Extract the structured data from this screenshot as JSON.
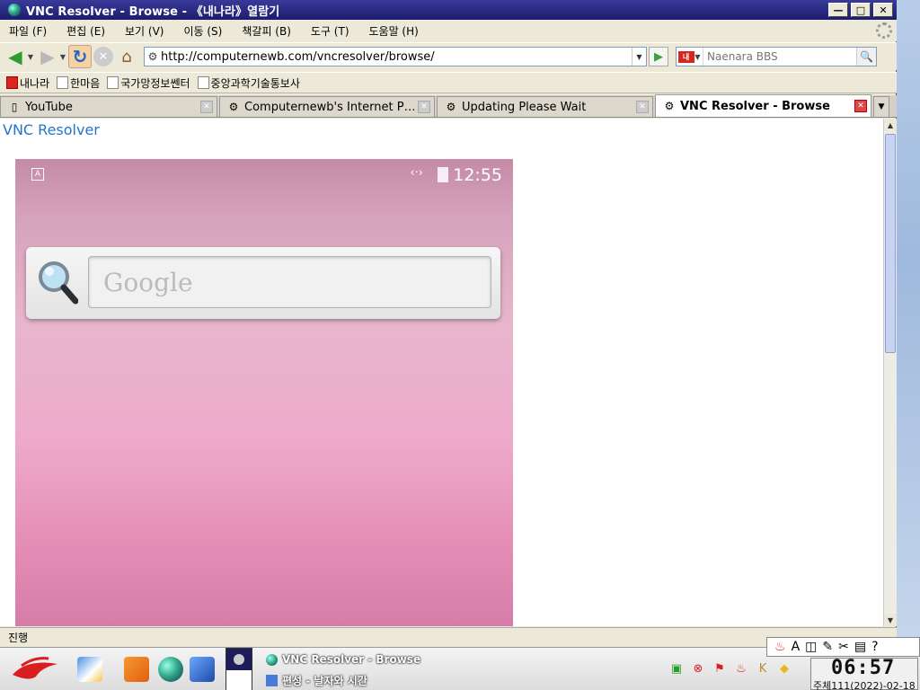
{
  "window": {
    "title": "VNC Resolver - Browse - 《내나라》열람기",
    "min_glyph": "—",
    "max_glyph": "□",
    "close_glyph": "✕"
  },
  "menu": [
    "파일 (F)",
    "편집 (E)",
    "보기 (V)",
    "이동 (S)",
    "책갈피 (B)",
    "도구 (T)",
    "도움말 (H)"
  ],
  "nav": {
    "url": "http://computernewb.com/vncresolver/browse/",
    "search_placeholder": "Naenara BBS",
    "search_engine_logo": "내"
  },
  "bookmarks": [
    "내나라",
    "한마음",
    "국가망정보쎈터",
    "중앙과학기술통보사"
  ],
  "tabs": [
    {
      "label": "YouTube",
      "icon": "page-icon",
      "active": false
    },
    {
      "label": "Computernewb's Internet P…",
      "icon": "site-icon",
      "active": false
    },
    {
      "label": "Updating Please Wait",
      "icon": "site-icon",
      "active": false
    },
    {
      "label": "VNC Resolver - Browse",
      "icon": "site-icon",
      "active": true
    }
  ],
  "page": {
    "heading_link": "VNC Resolver",
    "phone": {
      "status_icon": "A",
      "time": "12:55",
      "search_placeholder": "Google"
    }
  },
  "status_text": "진행",
  "taskbar": {
    "tasks": [
      "VNC Resolver - Browse",
      "편성 - 날자와 시간"
    ],
    "clock_time": "06:57",
    "clock_date": "주체111(2022)-02-18"
  },
  "colors": {
    "titlebar": "#1c1c6e",
    "link": "#2475c7",
    "phone_wallpaper": "#e7b6cc"
  }
}
